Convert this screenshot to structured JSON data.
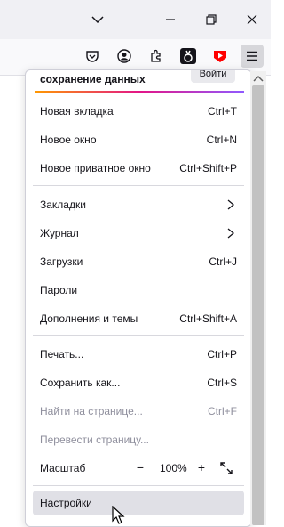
{
  "menu": {
    "sync_text": "сохранение данных",
    "signin_label": "Войти",
    "items": [
      {
        "label": "Новая вкладка",
        "shortcut": "Ctrl+T"
      },
      {
        "label": "Новое окно",
        "shortcut": "Ctrl+N"
      },
      {
        "label": "Новое приватное окно",
        "shortcut": "Ctrl+Shift+P"
      },
      {
        "label": "Закладки",
        "shortcut": ""
      },
      {
        "label": "Журнал",
        "shortcut": ""
      },
      {
        "label": "Загрузки",
        "shortcut": "Ctrl+J"
      },
      {
        "label": "Пароли",
        "shortcut": ""
      },
      {
        "label": "Дополнения и темы",
        "shortcut": "Ctrl+Shift+A"
      },
      {
        "label": "Печать...",
        "shortcut": "Ctrl+P"
      },
      {
        "label": "Сохранить как...",
        "shortcut": "Ctrl+S"
      },
      {
        "label": "Найти на странице...",
        "shortcut": "Ctrl+F"
      },
      {
        "label": "Перевести страницу...",
        "shortcut": ""
      },
      {
        "label": "Масштаб",
        "shortcut": ""
      },
      {
        "label": "Настройки",
        "shortcut": ""
      }
    ],
    "zoom": {
      "minus": "−",
      "value": "100%",
      "plus": "+"
    }
  },
  "toolbar": {
    "icons": [
      "pocket-icon",
      "account-icon",
      "extensions-icon",
      "extension-icon",
      "youtube-extension-icon",
      "hamburger-menu-icon"
    ]
  },
  "titlebar": {
    "icons": [
      "tab-list-chevron-icon",
      "minimize-icon",
      "restore-icon",
      "close-icon"
    ]
  },
  "colors": {
    "accent_gradient": [
      "#ff9900",
      "#e31587",
      "#9059ff"
    ],
    "youtube_red": "#ff0000",
    "hover": "#e0e0e6"
  }
}
